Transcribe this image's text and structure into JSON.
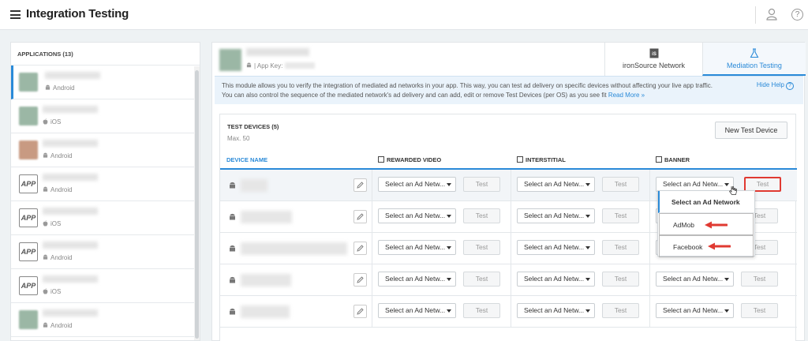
{
  "header": {
    "title": "Integration Testing"
  },
  "apps": {
    "heading": "APPLICATIONS (13)",
    "items": [
      {
        "os": "Android",
        "thumb": "green",
        "selected": true
      },
      {
        "os": "iOS",
        "thumb": "green"
      },
      {
        "os": "Android",
        "thumb": "orange"
      },
      {
        "os": "Android",
        "thumb": "app"
      },
      {
        "os": "iOS",
        "thumb": "app"
      },
      {
        "os": "Android",
        "thumb": "app"
      },
      {
        "os": "iOS",
        "thumb": "app"
      },
      {
        "os": "Android",
        "thumb": "green"
      }
    ],
    "app_icon_text": "APP"
  },
  "main": {
    "app_key_label": "| App Key:",
    "tabs": [
      {
        "label": "ironSource Network",
        "icon": "ironsource-icon"
      },
      {
        "label": "Mediation Testing",
        "icon": "flask-icon"
      }
    ],
    "info_text": "This module allows you to verify the integration of mediated ad networks in your app. This way, you can test ad delivery on specific devices without affecting your live app traffic. You can also control the sequence of the mediated network's ad delivery and can add, edit or remove Test Devices (per OS) as you see fit",
    "read_more": "Read More »",
    "hide_help": "Hide Help",
    "help_glyph": "?"
  },
  "devices": {
    "title": "TEST DEVICES (5)",
    "max": "Max. 50",
    "new_button": "New Test Device",
    "columns": {
      "device": "DEVICE NAME",
      "rewarded": "REWARDED VIDEO",
      "interstitial": "INTERSTITIAL",
      "banner": "BANNER"
    },
    "select_label": "Select an Ad Netw...",
    "select_label_open": "Select an Ad Netw...",
    "test_label": "Test",
    "rows": 5
  },
  "dropdown": {
    "options": [
      "Select an Ad Network",
      "AdMob",
      "Facebook"
    ],
    "selected": "Select an Ad Network"
  },
  "colors": {
    "accent": "#2a8ad8",
    "highlight": "#e03a32"
  }
}
